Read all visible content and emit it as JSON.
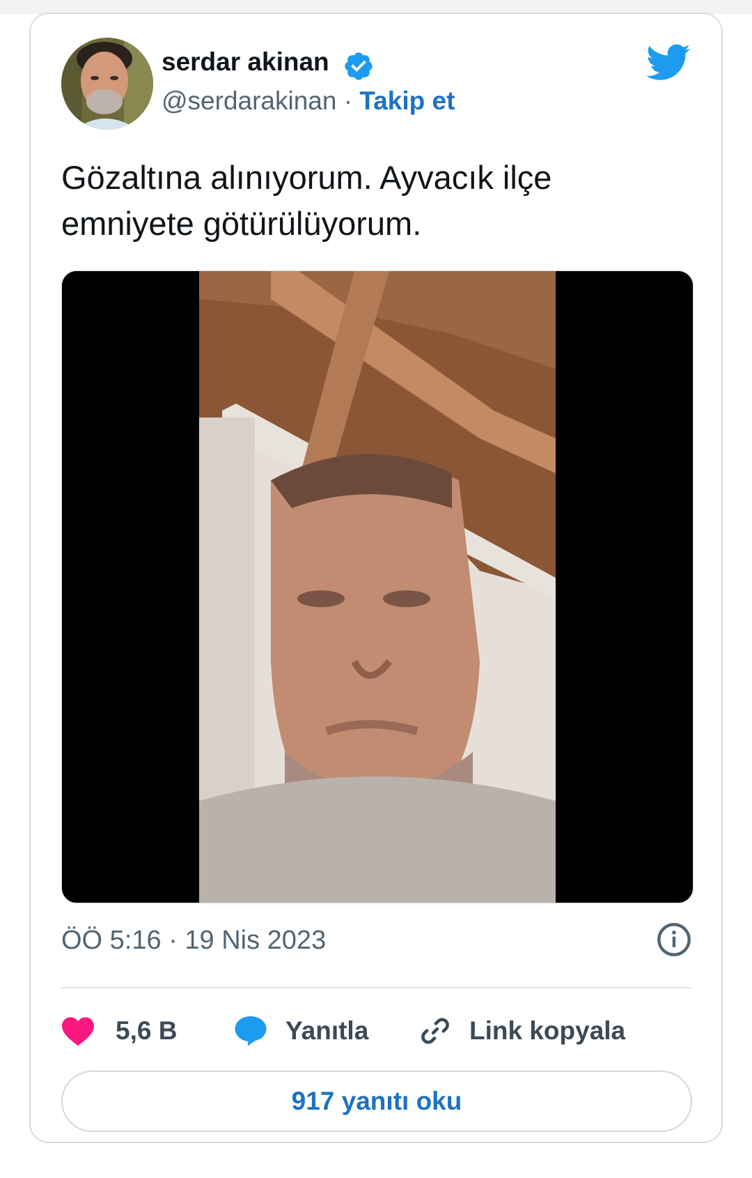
{
  "author": {
    "display_name": "serdar akinan",
    "handle": "@serdarakinan",
    "separator": " · ",
    "follow_label": "Takip et"
  },
  "icons": {
    "verified": "verified-badge-icon",
    "brand": "twitter-bird-icon",
    "info": "info-icon",
    "like": "heart-icon",
    "reply": "speech-bubble-icon",
    "link": "link-icon"
  },
  "tweet": {
    "text": "Gözaltına alınıyorum. Ayvacık ilçe emniyete götürülüyorum.",
    "timestamp": "ÖÖ 5:16 · 19 Nis 2023"
  },
  "actions": {
    "like_count": "5,6 B",
    "reply_label": "Yanıtla",
    "copy_link_label": "Link kopyala"
  },
  "replies_button": "917 yanıtı oku",
  "colors": {
    "accent": "#1d72c2",
    "twitter_blue": "#1d9bf0",
    "heart": "#f91880",
    "text": "#0f1419",
    "muted": "#536471"
  }
}
